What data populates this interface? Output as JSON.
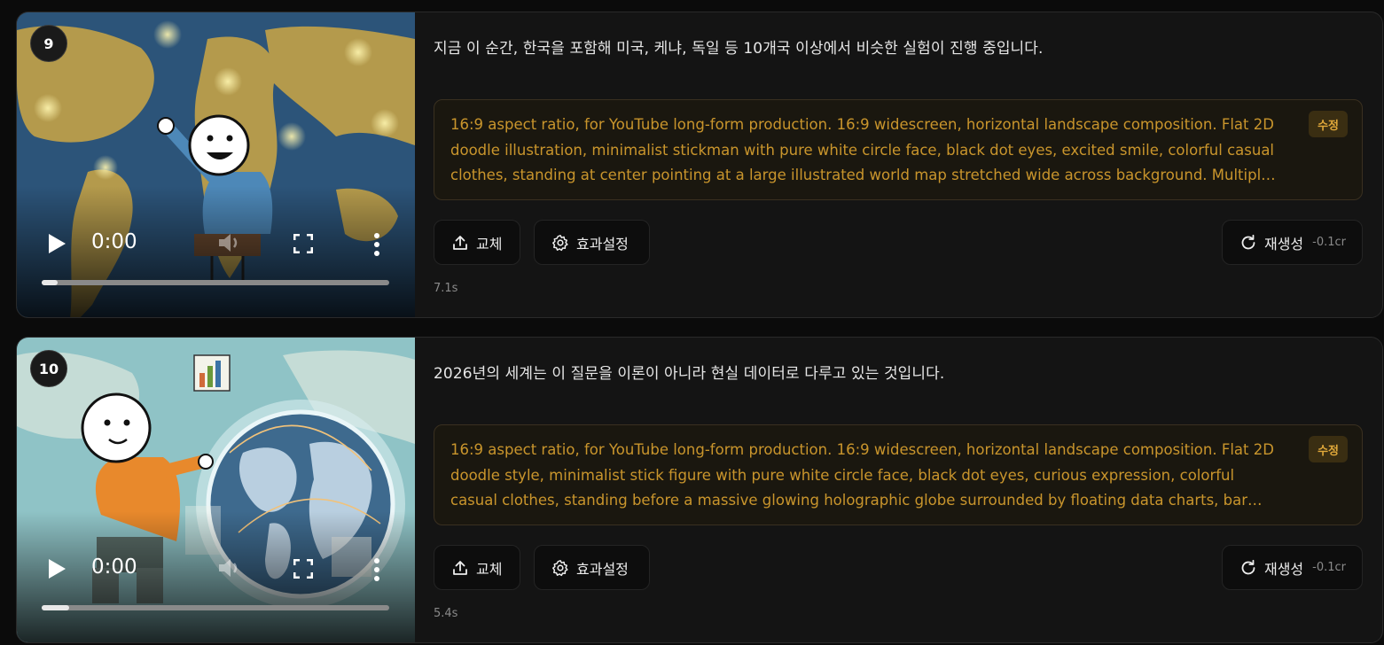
{
  "scenes": [
    {
      "number": "9",
      "time": "0:00",
      "progress": 0.045,
      "narration": "지금 이 순간, 한국을 포함해 미국, 케냐, 독일 등 10개국 이상에서 비슷한 실험이 진행 중입니다.",
      "prompt": "16:9 aspect ratio, for YouTube long-form production. 16:9 widescreen, horizontal landscape composition. Flat 2D doodle illustration, minimalist stickman with pure white circle face, black dot eyes, excited smile, colorful casual clothes, standing at center pointing at a large illustrated world map stretched wide across background. Multiple glowing lab flask icons an...",
      "edit_label": "수정",
      "replace_label": "교체",
      "effect_label": "효과설정",
      "regen_label": "재생성",
      "cost": "-0.1cr",
      "duration": "7.1s"
    },
    {
      "number": "10",
      "time": "0:00",
      "progress": 0.08,
      "narration": "2026년의 세계는 이 질문을 이론이 아니라 현실 데이터로 다루고 있는 것입니다.",
      "prompt": "16:9 aspect ratio, for YouTube long-form production. 16:9 widescreen, horizontal landscape composition. Flat 2D doodle style, minimalist stick figure with pure white circle face, black dot eyes, curious expression, colorful casual clothes, standing before a massive glowing holographic globe surrounded by floating data charts, bar graphs, and network node...",
      "edit_label": "수정",
      "replace_label": "교체",
      "effect_label": "효과설정",
      "regen_label": "재생성",
      "cost": "-0.1cr",
      "duration": "5.4s"
    }
  ],
  "colors": {
    "accent_text": "#c9952c",
    "badge_bg": "#3a2e12",
    "card_bg": "#141414"
  },
  "icons": [
    "play-icon",
    "volume-icon",
    "fullscreen-icon",
    "more-vertical-icon",
    "upload-icon",
    "gear-icon",
    "refresh-icon"
  ]
}
